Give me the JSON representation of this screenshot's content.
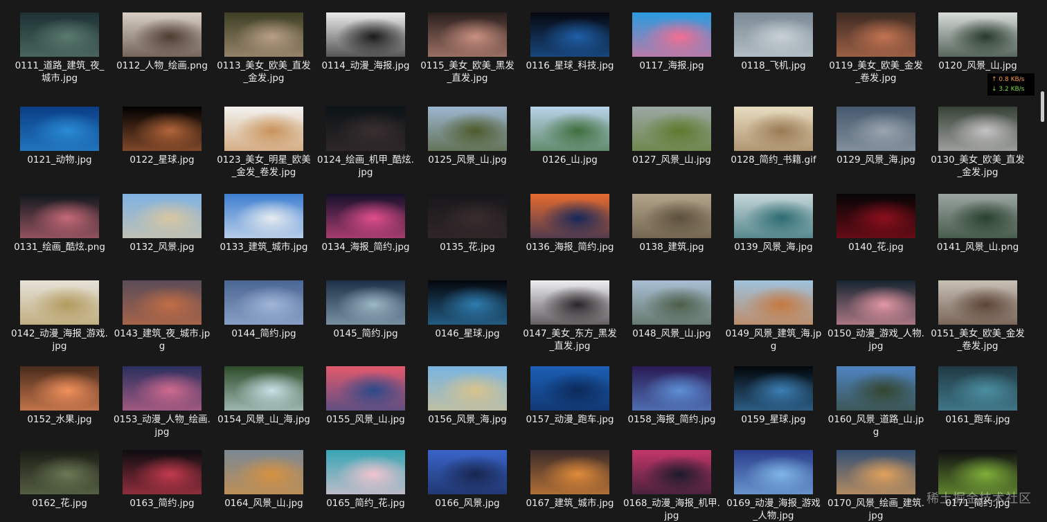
{
  "files": [
    {
      "name": "0111_道路_建筑_夜_城市.jpg",
      "colors": [
        "#1d3134",
        "#5a7a6e"
      ]
    },
    {
      "name": "0112_人物_绘画.png",
      "colors": [
        "#d9cfc4",
        "#4d3b30"
      ]
    },
    {
      "name": "0113_美女_欧美_直发_金发.jpg",
      "colors": [
        "#3d3f24",
        "#b89f86"
      ]
    },
    {
      "name": "0114_动漫_海报.jpg",
      "colors": [
        "#eaeaea",
        "#1a1a1a"
      ]
    },
    {
      "name": "0115_美女_欧美_黑发_直发.jpg",
      "colors": [
        "#2a1f1d",
        "#c99080"
      ]
    },
    {
      "name": "0116_星球_科技.jpg",
      "colors": [
        "#06080f",
        "#1f5fa8"
      ]
    },
    {
      "name": "0117_海报.jpg",
      "colors": [
        "#2a9be0",
        "#f26d91"
      ]
    },
    {
      "name": "0118_飞机.jpg",
      "colors": [
        "#7b8a95",
        "#c8d1d6"
      ]
    },
    {
      "name": "0119_美女_欧美_金发_卷发.jpg",
      "colors": [
        "#3c2a22",
        "#c27452"
      ]
    },
    {
      "name": "0120_风景_山.jpg",
      "colors": [
        "#d6dbd7",
        "#26392c"
      ]
    },
    {
      "name": "0121_动物.jpg",
      "colors": [
        "#0a3e86",
        "#2a8bd4"
      ]
    },
    {
      "name": "0122_星球.jpg",
      "colors": [
        "#000000",
        "#b3653a"
      ]
    },
    {
      "name": "0123_美女_明星_欧美_金发_卷发.jpg",
      "colors": [
        "#f2f2f0",
        "#c9925a"
      ]
    },
    {
      "name": "0124_绘画_机甲_酷炫.jpg",
      "colors": [
        "#0d1416",
        "#3b2f31"
      ]
    },
    {
      "name": "0125_风景_山.jpg",
      "colors": [
        "#9cb6cf",
        "#4e5a2b"
      ]
    },
    {
      "name": "0126_山.jpg",
      "colors": [
        "#b9d3ea",
        "#3f6e3c"
      ]
    },
    {
      "name": "0127_风景_山.jpg",
      "colors": [
        "#9ba8a3",
        "#5d7a2d"
      ]
    },
    {
      "name": "0128_简约_书籍.gif",
      "colors": [
        "#e7dcc0",
        "#9a7a53"
      ]
    },
    {
      "name": "0129_风景_海.jpg",
      "colors": [
        "#46596d",
        "#99a4ae"
      ]
    },
    {
      "name": "0130_美女_欧美_直发_金发.jpg",
      "colors": [
        "#374237",
        "#c5c3c4"
      ]
    },
    {
      "name": "0131_绘画_酷炫.png",
      "colors": [
        "#11181d",
        "#c76a78"
      ]
    },
    {
      "name": "0132_风景.jpg",
      "colors": [
        "#7fb2e2",
        "#d8c6a1"
      ]
    },
    {
      "name": "0133_建筑_城市.jpg",
      "colors": [
        "#3f7fd1",
        "#e7ecf0"
      ]
    },
    {
      "name": "0134_海报_简约.jpg",
      "colors": [
        "#15102a",
        "#e24f8c"
      ]
    },
    {
      "name": "0135_花.jpg",
      "colors": [
        "#17171a",
        "#3a2c2e"
      ]
    },
    {
      "name": "0136_海报_简约.jpg",
      "colors": [
        "#e66b2f",
        "#16285a"
      ]
    },
    {
      "name": "0138_建筑.jpg",
      "colors": [
        "#b2a48a",
        "#5c4f3c"
      ]
    },
    {
      "name": "0139_风景_海.jpg",
      "colors": [
        "#c5d5d8",
        "#2c6b71"
      ]
    },
    {
      "name": "0140_花.jpg",
      "colors": [
        "#050505",
        "#8d0f1d"
      ]
    },
    {
      "name": "0141_风景_山.png",
      "colors": [
        "#9aa4a0",
        "#28402d"
      ]
    },
    {
      "name": "0142_动漫_海报_游戏.jpg",
      "colors": [
        "#e6e2d8",
        "#b29a5e"
      ]
    },
    {
      "name": "0143_建筑_夜_城市.jpg",
      "colors": [
        "#5b4c57",
        "#c26d45"
      ]
    },
    {
      "name": "0144_简约.jpg",
      "colors": [
        "#4a6693",
        "#a0b6d8"
      ]
    },
    {
      "name": "0145_简约.jpg",
      "colors": [
        "#1d3047",
        "#9cb7c6"
      ]
    },
    {
      "name": "0146_星球.jpg",
      "colors": [
        "#05070d",
        "#2f7db0"
      ]
    },
    {
      "name": "0147_美女_东方_黑发_直发.jpg",
      "colors": [
        "#eeeef0",
        "#2a2528"
      ]
    },
    {
      "name": "0148_风景_山.jpg",
      "colors": [
        "#a9bfd4",
        "#4c5e49"
      ]
    },
    {
      "name": "0149_风景_建筑_海.jpg",
      "colors": [
        "#9fc2dc",
        "#c6783f"
      ]
    },
    {
      "name": "0150_动漫_游戏_人物.jpg",
      "colors": [
        "#172530",
        "#e497a4"
      ]
    },
    {
      "name": "0151_美女_欧美_金发_卷发.jpg",
      "colors": [
        "#c8bfb5",
        "#5b4436"
      ]
    },
    {
      "name": "0152_水果.jpg",
      "colors": [
        "#4a2c1c",
        "#f2905c"
      ]
    },
    {
      "name": "0153_动漫_人物_绘画.jpg",
      "colors": [
        "#2a2f5e",
        "#d06a8e"
      ]
    },
    {
      "name": "0154_风景_山_海.jpg",
      "colors": [
        "#2e4d2a",
        "#c9e0e6"
      ]
    },
    {
      "name": "0155_风景_山.jpg",
      "colors": [
        "#e35a6e",
        "#2b4a8a"
      ]
    },
    {
      "name": "0156_风景_海.jpg",
      "colors": [
        "#7ab4e0",
        "#d9c38b"
      ]
    },
    {
      "name": "0157_动漫_跑车.jpg",
      "colors": [
        "#1c5fb5",
        "#0c2a5a"
      ]
    },
    {
      "name": "0158_海报_简约.jpg",
      "colors": [
        "#2a1b55",
        "#5d8fd6"
      ]
    },
    {
      "name": "0159_星球.jpg",
      "colors": [
        "#030609",
        "#3c7fb5"
      ]
    },
    {
      "name": "0160_风景_道路_山.jpg",
      "colors": [
        "#4f84c2",
        "#34452d"
      ]
    },
    {
      "name": "0161_跑车.jpg",
      "colors": [
        "#203a44",
        "#4c8fa2"
      ]
    },
    {
      "name": "0162_花.jpg",
      "colors": [
        "#1a1d15",
        "#6b7854"
      ]
    },
    {
      "name": "0163_简约.jpg",
      "colors": [
        "#0c0d10",
        "#c43a4d"
      ]
    },
    {
      "name": "0164_风景_山.jpg",
      "colors": [
        "#7b8893",
        "#d7913f"
      ]
    },
    {
      "name": "0165_简约_花.jpg",
      "colors": [
        "#36a5b4",
        "#f2c4cf"
      ]
    },
    {
      "name": "0166_风景.jpg",
      "colors": [
        "#3a64c9",
        "#17264f"
      ]
    },
    {
      "name": "0167_建筑_城市.jpg",
      "colors": [
        "#3a2a2a",
        "#e08b3a"
      ]
    },
    {
      "name": "0168_动漫_海报_机甲.jpg",
      "colors": [
        "#c4366a",
        "#1b1b2a"
      ]
    },
    {
      "name": "0169_动漫_海报_游戏_人物.jpg",
      "colors": [
        "#2b3e8c",
        "#7fb6e6"
      ]
    },
    {
      "name": "0170_风景_绘画_建筑.jpg",
      "colors": [
        "#344f72",
        "#e2a15a"
      ]
    },
    {
      "name": "0171_简约.jpg",
      "colors": [
        "#101012",
        "#7fb03a"
      ]
    }
  ],
  "net_speed": {
    "up": "↑ 0.8 KB/s",
    "down": "↓ 3.2 KB/s",
    "up_color": "#ff9b3d",
    "down_color": "#7ddc3c"
  },
  "watermark": "稀土掘金技术社区",
  "background": "#191919"
}
